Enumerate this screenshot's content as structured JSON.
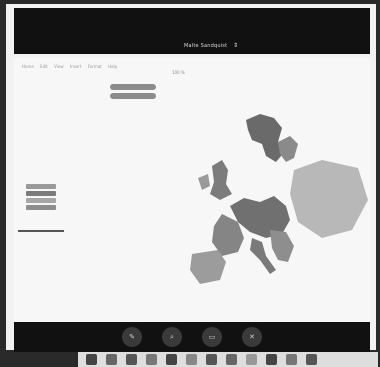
{
  "top_bar": {
    "title": "Malte Sandquist",
    "chevron": "⇕"
  },
  "menu": [
    "Home",
    "Edit",
    "View",
    "Insert",
    "Format",
    "Help"
  ],
  "zoom": "100 %",
  "legend": {
    "swatch_colors": [
      "#9a9a9a",
      "#7b7b7b",
      "#a6a6a6",
      "#8d8d8d"
    ]
  },
  "controls": {
    "buttons": [
      {
        "icon": "pen-icon",
        "glyph": "✎"
      },
      {
        "icon": "zoom-icon",
        "glyph": "⌕"
      },
      {
        "icon": "screen-icon",
        "glyph": "▭"
      },
      {
        "icon": "close-icon",
        "glyph": "✕"
      }
    ]
  }
}
